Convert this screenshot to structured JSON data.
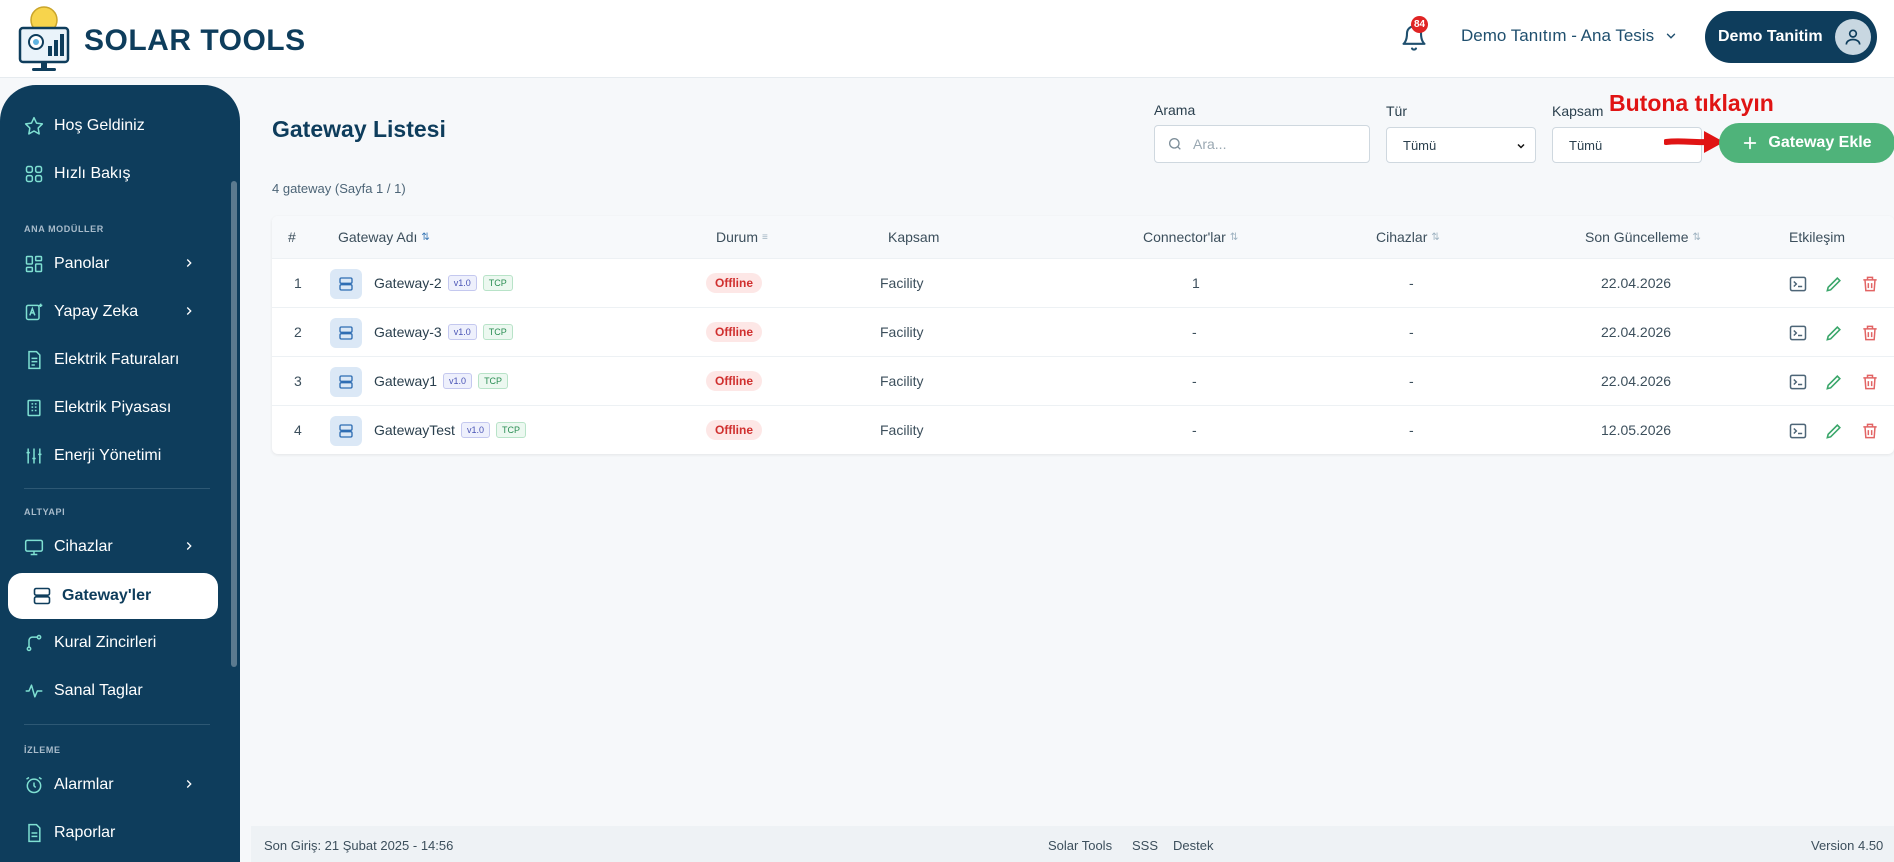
{
  "header": {
    "brand": "SOLAR TOOLS",
    "notification_count": "84",
    "facility": "Demo Tanıtım - Ana Tesis",
    "user": "Demo Tanitim"
  },
  "sidebar": {
    "items": [
      {
        "label": "Hoş Geldiniz",
        "icon": "star-icon"
      },
      {
        "label": "Hızlı Bakış",
        "icon": "grid-icon"
      }
    ],
    "section_main": "ANA MODÜLLER",
    "main_items": [
      {
        "label": "Panolar",
        "icon": "dashboard-icon"
      },
      {
        "label": "Yapay Zeka",
        "icon": "ai-icon"
      },
      {
        "label": "Elektrik Faturaları",
        "icon": "invoice-icon"
      },
      {
        "label": "Elektrik Piyasası",
        "icon": "building-icon"
      },
      {
        "label": "Enerji Yönetimi",
        "icon": "sliders-icon"
      }
    ],
    "section_infra": "ALTYAPI",
    "infra_items": [
      {
        "label": "Cihazlar",
        "icon": "monitor-icon"
      },
      {
        "label": "Gateway'ler",
        "icon": "server-icon"
      },
      {
        "label": "Kural Zincirleri",
        "icon": "branch-icon"
      },
      {
        "label": "Sanal Taglar",
        "icon": "pulse-icon"
      }
    ],
    "section_monitor": "İZLEME",
    "monitor_items": [
      {
        "label": "Alarmlar",
        "icon": "alarm-icon"
      },
      {
        "label": "Raporlar",
        "icon": "report-icon"
      }
    ]
  },
  "main": {
    "title": "Gateway Listesi",
    "subinfo": "4 gateway (Sayfa 1 / 1)",
    "search_label": "Arama",
    "search_placeholder": "Ara...",
    "type_label": "Tür",
    "type_value": "Tümü",
    "scope_label": "Kapsam",
    "scope_value": "Tümü",
    "add_button": "Gateway Ekle",
    "annotation": "Butona tıklayın"
  },
  "table": {
    "columns": [
      "#",
      "Gateway Adı",
      "Durum",
      "Kapsam",
      "Connector'lar",
      "Cihazlar",
      "Son Güncelleme",
      "Etkileşim"
    ],
    "rows": [
      {
        "num": "1",
        "name": "Gateway-2",
        "version": "v1.0",
        "protocol": "TCP",
        "status": "Offline",
        "scope": "Facility",
        "connectors": "1",
        "devices": "-",
        "updated": "22.04.2026"
      },
      {
        "num": "2",
        "name": "Gateway-3",
        "version": "v1.0",
        "protocol": "TCP",
        "status": "Offline",
        "scope": "Facility",
        "connectors": "-",
        "devices": "-",
        "updated": "22.04.2026"
      },
      {
        "num": "3",
        "name": "Gateway1",
        "version": "v1.0",
        "protocol": "TCP",
        "status": "Offline",
        "scope": "Facility",
        "connectors": "-",
        "devices": "-",
        "updated": "22.04.2026"
      },
      {
        "num": "4",
        "name": "GatewayTest",
        "version": "v1.0",
        "protocol": "TCP",
        "status": "Offline",
        "scope": "Facility",
        "connectors": "-",
        "devices": "-",
        "updated": "12.05.2026"
      }
    ]
  },
  "footer": {
    "last_login": "Son Giriş: 21 Şubat 2025 - 14:56",
    "links": [
      "Solar Tools",
      "SSS",
      "Destek"
    ],
    "version": "Version 4.50"
  },
  "colors": {
    "primary": "#0e3d5c",
    "accent_green": "#4fb37a",
    "offline_red": "#d0302f",
    "annotation_red": "#e01414"
  }
}
